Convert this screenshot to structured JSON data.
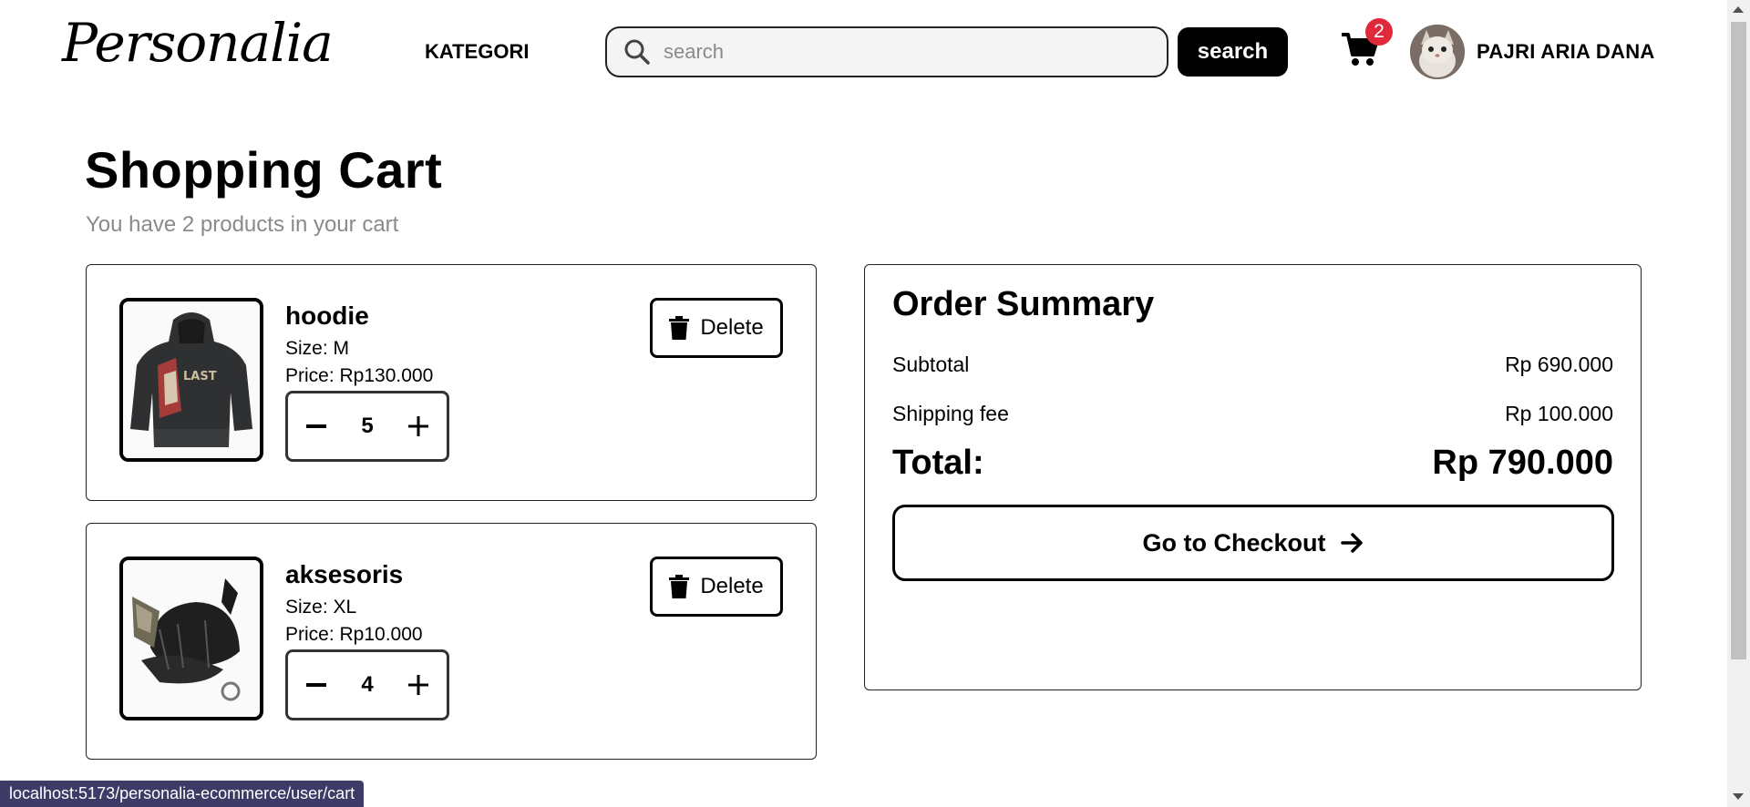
{
  "header": {
    "logo": "Personalia",
    "nav_kategori": "KATEGORI",
    "search": {
      "placeholder": "search",
      "value": "",
      "button_label": "search"
    },
    "cart_count": "2",
    "user_name": "PAJRI ARIA DANA"
  },
  "page": {
    "title": "Shopping Cart",
    "subtitle": "You have 2 products in your cart"
  },
  "cart_items": [
    {
      "name": "hoodie",
      "size": "Size: M",
      "price": "Price: Rp130.000",
      "quantity": "5",
      "delete_label": "Delete"
    },
    {
      "name": "aksesoris",
      "size": "Size: XL",
      "price": "Price: Rp10.000",
      "quantity": "4",
      "delete_label": "Delete"
    }
  ],
  "summary": {
    "title": "Order Summary",
    "subtotal_label": "Subtotal",
    "subtotal_value": "Rp 690.000",
    "shipping_label": "Shipping fee",
    "shipping_value": "Rp 100.000",
    "total_label": "Total:",
    "total_value": "Rp 790.000",
    "checkout_label": "Go to Checkout"
  },
  "status_bar": {
    "url": "localhost:5173/personalia-ecommerce/user/cart"
  },
  "colors": {
    "badge": "#e0293b",
    "status_bar": "#3e3b66",
    "button_dark": "#000000"
  },
  "icons": [
    "search-icon",
    "cart-icon",
    "trash-icon",
    "minus-icon",
    "plus-icon",
    "arrow-right-icon"
  ]
}
